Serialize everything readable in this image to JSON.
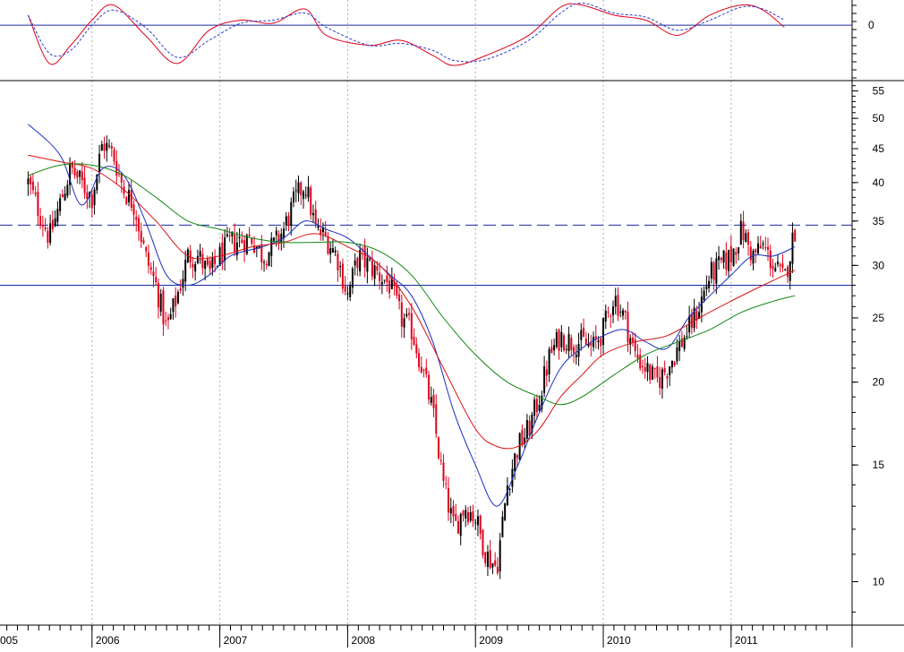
{
  "chart_data": [
    {
      "type": "line",
      "panel": "oscillator",
      "yticks": [
        {
          "label": "0",
          "value": 0
        }
      ],
      "ylim": [
        -55,
        25
      ],
      "grid": true,
      "series": [
        {
          "style": "solid",
          "color": "#e0001b",
          "x": [
            "2005-07",
            "2005-09",
            "2005-11",
            "2006-01",
            "2006-03",
            "2006-06",
            "2006-09",
            "2006-12",
            "2007-03",
            "2007-06",
            "2007-09",
            "2007-11",
            "2008-03",
            "2008-06",
            "2008-09",
            "2008-11",
            "2009-02",
            "2009-06",
            "2009-09",
            "2009-11",
            "2010-02",
            "2010-05",
            "2010-08",
            "2010-11",
            "2011-02",
            "2011-04",
            "2011-06"
          ],
          "values": [
            10,
            -38,
            -20,
            5,
            20,
            -10,
            -38,
            -5,
            5,
            2,
            16,
            -10,
            -20,
            -15,
            -30,
            -40,
            -30,
            -10,
            18,
            20,
            10,
            5,
            -10,
            10,
            20,
            15,
            -2
          ]
        },
        {
          "style": "dashed",
          "color": "#2a3bd4",
          "x": [
            "2005-07",
            "2005-09",
            "2005-11",
            "2006-01",
            "2006-03",
            "2006-06",
            "2006-09",
            "2006-12",
            "2007-03",
            "2007-06",
            "2007-09",
            "2007-11",
            "2008-03",
            "2008-06",
            "2008-09",
            "2008-11",
            "2009-02",
            "2009-06",
            "2009-09",
            "2009-11",
            "2010-02",
            "2010-05",
            "2010-08",
            "2010-11",
            "2011-02",
            "2011-04",
            "2011-06"
          ],
          "values": [
            10,
            -28,
            -25,
            0,
            15,
            -2,
            -32,
            -15,
            2,
            5,
            12,
            -2,
            -20,
            -18,
            -25,
            -35,
            -34,
            -15,
            12,
            22,
            12,
            8,
            -5,
            5,
            18,
            16,
            5
          ]
        }
      ]
    },
    {
      "type": "candlestick",
      "panel": "price",
      "yscale": "log",
      "ylim": [
        8.6,
        57
      ],
      "yticks": [
        10,
        15,
        20,
        25,
        30,
        35,
        40,
        45,
        50,
        55
      ],
      "xticks": [
        "005",
        "2006",
        "2007",
        "2008",
        "2009",
        "2010",
        "2011"
      ],
      "grid": true,
      "hlines": [
        {
          "value": 34.5,
          "style": "dashed",
          "color": "#1a2a9c"
        },
        {
          "value": 28,
          "style": "solid",
          "color": "#1a2a9c"
        }
      ],
      "colors": {
        "up": "#000000",
        "down": "#e0001b"
      },
      "path": [
        [
          "2005-07",
          40
        ],
        [
          "2005-09",
          33
        ],
        [
          "2005-11",
          42
        ],
        [
          "2006-01",
          38
        ],
        [
          "2006-02",
          46
        ],
        [
          "2006-03",
          44
        ],
        [
          "2006-04",
          39
        ],
        [
          "2006-05",
          37
        ],
        [
          "2006-06",
          31
        ],
        [
          "2006-07",
          28
        ],
        [
          "2006-08",
          24
        ],
        [
          "2006-09",
          27
        ],
        [
          "2006-10",
          31
        ],
        [
          "2006-11",
          31
        ],
        [
          "2006-12",
          29
        ],
        [
          "2007-01",
          31
        ],
        [
          "2007-02",
          32.5
        ],
        [
          "2007-04",
          33
        ],
        [
          "2007-05",
          31
        ],
        [
          "2007-06",
          32
        ],
        [
          "2007-07",
          34
        ],
        [
          "2007-08",
          37.5
        ],
        [
          "2007-09",
          40
        ],
        [
          "2007-10",
          34
        ],
        [
          "2007-11",
          33
        ],
        [
          "2007-12",
          31
        ],
        [
          "2008-01",
          27
        ],
        [
          "2008-02",
          31
        ],
        [
          "2008-03",
          30
        ],
        [
          "2008-04",
          29
        ],
        [
          "2008-05",
          28
        ],
        [
          "2008-06",
          25
        ],
        [
          "2008-07",
          24
        ],
        [
          "2008-08",
          21
        ],
        [
          "2008-09",
          18
        ],
        [
          "2008-10",
          14
        ],
        [
          "2008-11",
          12
        ],
        [
          "2008-12",
          13
        ],
        [
          "2009-01",
          12.5
        ],
        [
          "2009-02",
          11
        ],
        [
          "2009-03",
          10.5
        ],
        [
          "2009-04",
          14
        ],
        [
          "2009-05",
          16
        ],
        [
          "2009-06",
          17
        ],
        [
          "2009-07",
          19
        ],
        [
          "2009-08",
          22
        ],
        [
          "2009-09",
          23.5
        ],
        [
          "2009-10",
          23
        ],
        [
          "2009-11",
          23
        ],
        [
          "2009-12",
          22.5
        ],
        [
          "2010-01",
          24
        ],
        [
          "2010-02",
          27
        ],
        [
          "2010-03",
          25
        ],
        [
          "2010-04",
          22
        ],
        [
          "2010-05",
          21
        ],
        [
          "2010-06",
          20
        ],
        [
          "2010-07",
          21
        ],
        [
          "2010-08",
          22.5
        ],
        [
          "2010-09",
          24
        ],
        [
          "2010-10",
          26
        ],
        [
          "2010-11",
          29
        ],
        [
          "2010-12",
          30
        ],
        [
          "2011-01",
          31
        ],
        [
          "2011-02",
          34
        ],
        [
          "2011-03",
          31
        ],
        [
          "2011-04",
          32
        ],
        [
          "2011-05",
          30
        ],
        [
          "2011-06",
          28.5
        ],
        [
          "2011-07",
          34
        ]
      ],
      "moving_averages": [
        {
          "name": "",
          "color": "#1b2ec4",
          "points": [
            [
              "2005-07",
              49
            ],
            [
              "2005-10",
              44
            ],
            [
              "2005-12",
              37
            ],
            [
              "2006-02",
              42
            ],
            [
              "2006-04",
              41
            ],
            [
              "2006-06",
              35
            ],
            [
              "2006-08",
              29
            ],
            [
              "2006-10",
              28
            ],
            [
              "2006-12",
              29
            ],
            [
              "2007-02",
              31
            ],
            [
              "2007-05",
              32
            ],
            [
              "2007-07",
              33
            ],
            [
              "2007-09",
              35
            ],
            [
              "2007-11",
              34
            ],
            [
              "2008-01",
              33
            ],
            [
              "2008-03",
              31
            ],
            [
              "2008-05",
              29
            ],
            [
              "2008-07",
              27
            ],
            [
              "2008-09",
              23
            ],
            [
              "2008-11",
              18
            ],
            [
              "2009-01",
              15
            ],
            [
              "2009-03",
              13
            ],
            [
              "2009-05",
              15
            ],
            [
              "2009-07",
              18
            ],
            [
              "2009-09",
              21
            ],
            [
              "2009-11",
              22.5
            ],
            [
              "2010-01",
              23.5
            ],
            [
              "2010-03",
              24
            ],
            [
              "2010-05",
              23
            ],
            [
              "2010-07",
              22.5
            ],
            [
              "2010-09",
              25
            ],
            [
              "2010-11",
              27
            ],
            [
              "2011-01",
              29
            ],
            [
              "2011-03",
              31
            ],
            [
              "2011-05",
              31
            ],
            [
              "2011-07",
              32
            ]
          ]
        },
        {
          "name": "",
          "color": "#dd1111",
          "points": [
            [
              "2005-07",
              44
            ],
            [
              "2005-10",
              43
            ],
            [
              "2006-01",
              42
            ],
            [
              "2006-04",
              39
            ],
            [
              "2006-07",
              35
            ],
            [
              "2006-10",
              31
            ],
            [
              "2007-01",
              31
            ],
            [
              "2007-04",
              32
            ],
            [
              "2007-07",
              32.5
            ],
            [
              "2007-10",
              33.5
            ],
            [
              "2008-01",
              32
            ],
            [
              "2008-04",
              30
            ],
            [
              "2008-07",
              26
            ],
            [
              "2008-10",
              21
            ],
            [
              "2009-01",
              17
            ],
            [
              "2009-03",
              16
            ],
            [
              "2009-05",
              16
            ],
            [
              "2009-07",
              17
            ],
            [
              "2009-09",
              19
            ],
            [
              "2009-11",
              20.5
            ],
            [
              "2010-01",
              22
            ],
            [
              "2010-04",
              23
            ],
            [
              "2010-07",
              23.5
            ],
            [
              "2010-10",
              25
            ],
            [
              "2011-01",
              26.5
            ],
            [
              "2011-04",
              28
            ],
            [
              "2011-07",
              29.5
            ]
          ]
        },
        {
          "name": "",
          "color": "#118811",
          "points": [
            [
              "2005-07",
              41
            ],
            [
              "2005-10",
              42.5
            ],
            [
              "2006-01",
              42.5
            ],
            [
              "2006-04",
              41
            ],
            [
              "2006-07",
              38
            ],
            [
              "2006-10",
              35
            ],
            [
              "2007-01",
              34
            ],
            [
              "2007-04",
              33
            ],
            [
              "2007-07",
              32.5
            ],
            [
              "2007-10",
              32.5
            ],
            [
              "2008-01",
              32.5
            ],
            [
              "2008-04",
              31.5
            ],
            [
              "2008-07",
              29
            ],
            [
              "2008-10",
              25
            ],
            [
              "2009-01",
              22
            ],
            [
              "2009-04",
              20
            ],
            [
              "2009-07",
              19
            ],
            [
              "2009-09",
              18.5
            ],
            [
              "2009-11",
              19
            ],
            [
              "2010-02",
              20.5
            ],
            [
              "2010-05",
              22
            ],
            [
              "2010-08",
              23
            ],
            [
              "2010-11",
              24
            ],
            [
              "2011-02",
              25.5
            ],
            [
              "2011-05",
              26.5
            ],
            [
              "2011-07",
              27
            ]
          ]
        }
      ]
    }
  ]
}
